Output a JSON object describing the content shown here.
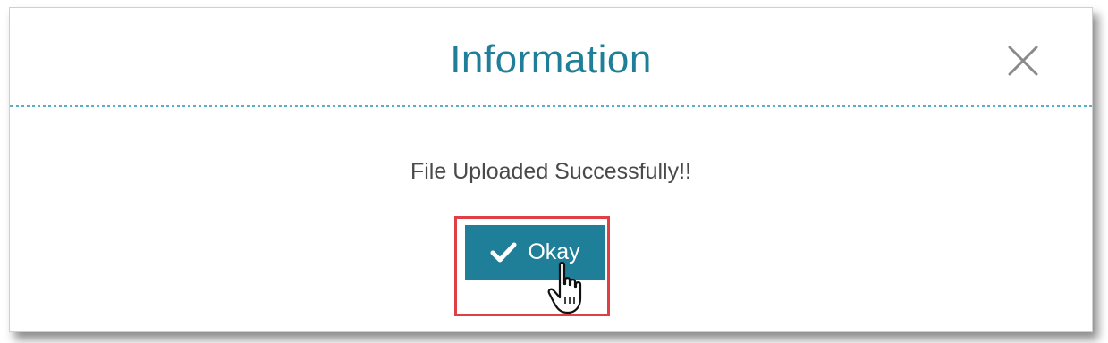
{
  "dialog": {
    "title": "Information",
    "close_icon": "close-icon",
    "message": "File Uploaded Successfully!!",
    "okay_button": {
      "label": "Okay",
      "icon": "check-icon"
    }
  },
  "overlay": {
    "highlight_color": "#e04045",
    "cursor_icon": "hand-pointer-icon"
  },
  "colors": {
    "accent": "#1f7f98",
    "divider": "#5aaecb",
    "text": "#4a4a4a"
  }
}
